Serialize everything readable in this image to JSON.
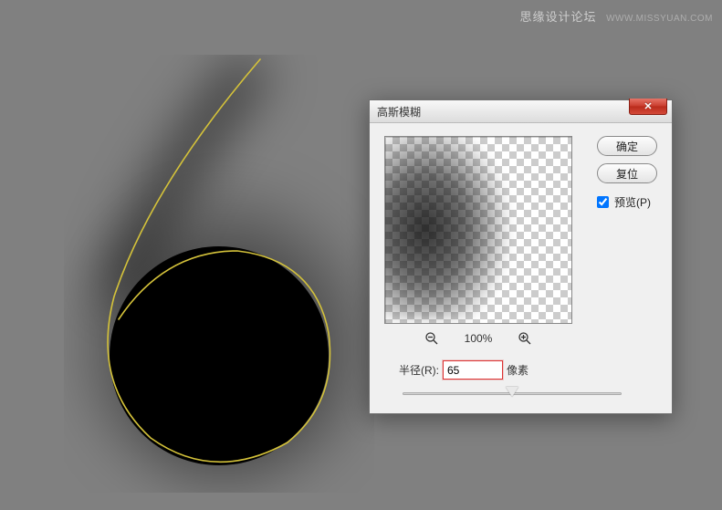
{
  "watermark": {
    "main": "思缘设计论坛",
    "sub": "WWW.MISSYUAN.COM"
  },
  "dialog": {
    "title": "高斯模糊",
    "close_glyph": "✕",
    "ok_label": "确定",
    "reset_label": "复位",
    "preview_label": "预览(P)",
    "preview_checked": true,
    "zoom_level": "100%",
    "radius_label": "半径(R):",
    "radius_value": "65",
    "radius_unit": "像素"
  }
}
